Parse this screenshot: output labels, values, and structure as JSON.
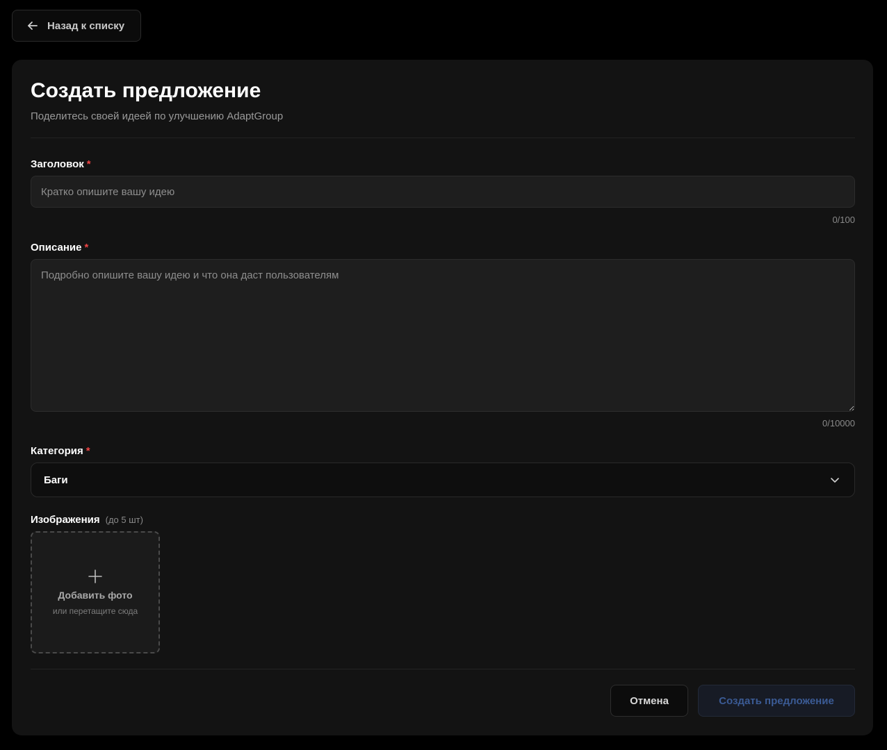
{
  "nav": {
    "back_label": "Назад к списку",
    "back_icon": "arrow-left-icon"
  },
  "form": {
    "title": "Создать предложение",
    "subtitle": "Поделитесь своей идеей по улучшению AdaptGroup",
    "required_mark": "*",
    "heading_field": {
      "label": "Заголовок",
      "placeholder": "Кратко опишите вашу идею",
      "value": "",
      "counter": "0/100"
    },
    "description_field": {
      "label": "Описание",
      "placeholder": "Подробно опишите вашу идею и что она даст пользователям",
      "value": "",
      "counter": "0/10000"
    },
    "category_field": {
      "label": "Категория",
      "selected": "Баги",
      "icon": "chevron-down-icon"
    },
    "images_field": {
      "label": "Изображения",
      "hint": "(до 5 шт)",
      "upload_title": "Добавить фото",
      "upload_subtitle": "или перетащите сюда",
      "icon": "plus-icon"
    },
    "actions": {
      "cancel_label": "Отмена",
      "submit_label": "Создать предложение"
    }
  },
  "colors": {
    "background": "#000000",
    "card": "#131313",
    "required": "#ef4444",
    "submit_text": "#3b5b95"
  }
}
